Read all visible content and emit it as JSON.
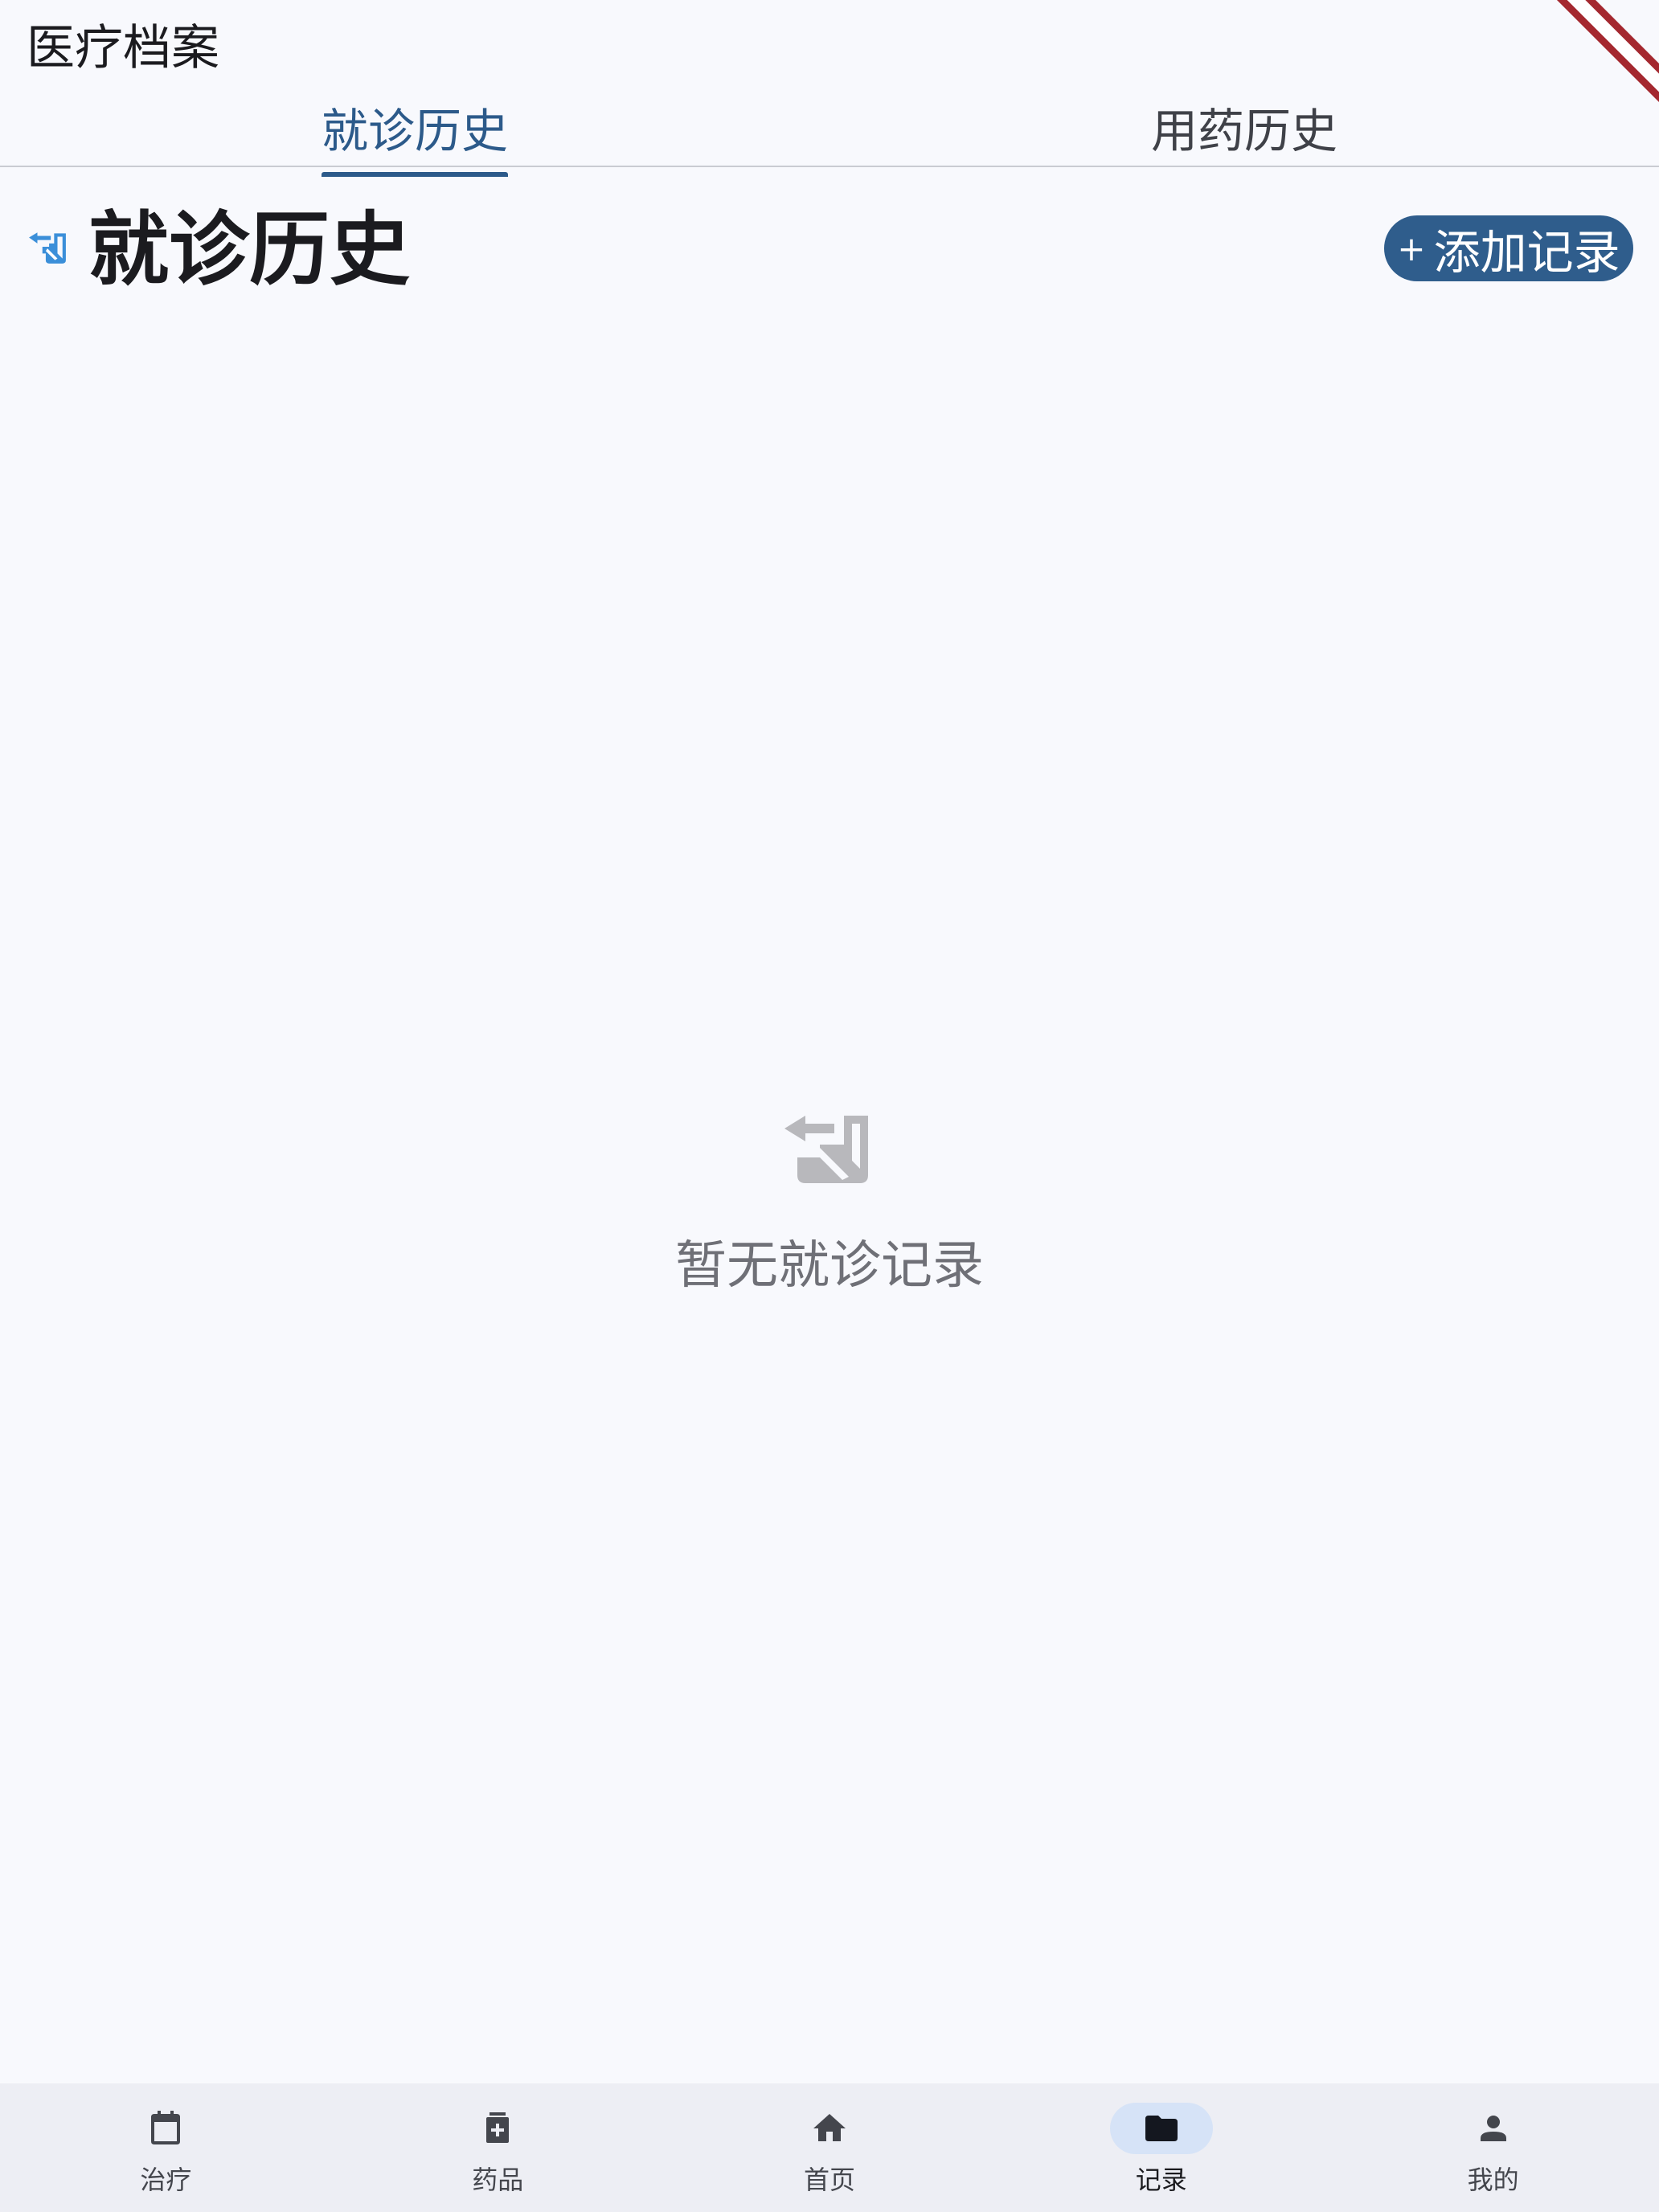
{
  "app_bar": {
    "title": "医疗档案"
  },
  "tabs": [
    {
      "label": "就诊历史",
      "active": true
    },
    {
      "label": "用药历史",
      "active": false
    }
  ],
  "section": {
    "icon": "medical-history-icon",
    "title": "就诊历史",
    "add_button": {
      "plus": "+",
      "label": "添加记录"
    }
  },
  "empty_state": {
    "icon": "medical-history-icon",
    "text": "暂无就诊记录"
  },
  "bottom_nav": [
    {
      "label": "治疗",
      "icon": "calendar-icon",
      "active": false
    },
    {
      "label": "药品",
      "icon": "medicine-bottle-icon",
      "active": false
    },
    {
      "label": "首页",
      "icon": "home-icon",
      "active": false
    },
    {
      "label": "记录",
      "icon": "folder-icon",
      "active": true
    },
    {
      "label": "我的",
      "icon": "person-icon",
      "active": false
    }
  ],
  "colors": {
    "primary": "#2f5d8c",
    "tab_active": "#2c5a8a",
    "section_icon": "#3b8fd9",
    "background": "#f8f9fd",
    "nav_background": "#edeef4",
    "nav_active_pill": "#d6e3f7",
    "empty_text": "#6f7077",
    "debug_banner": "#a4282f"
  }
}
